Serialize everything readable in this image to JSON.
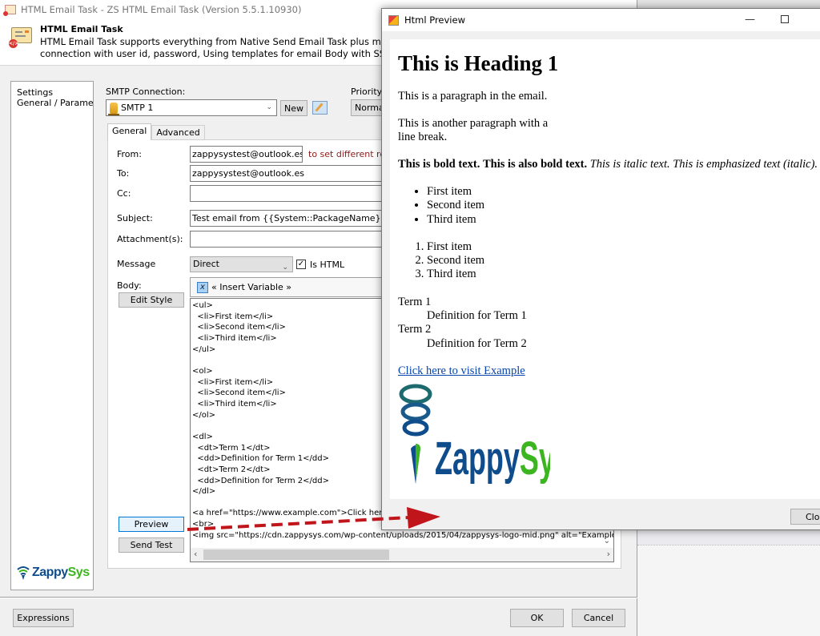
{
  "main_window": {
    "title": "HTML Email Task - ZS HTML Email Task (Version 5.5.1.10930)",
    "header": {
      "title": "HTML Email Task",
      "description_line1": "HTML Email Task supports everything from Native Send Email Task plus much more such",
      "description_line2": "connection with user id, password, Using templates for email Body with SSIS Variable plac"
    },
    "nav": {
      "items": [
        {
          "label": "Settings"
        },
        {
          "label": "General / Parameters"
        }
      ],
      "logo_part1": "Zappy",
      "logo_part2": "Sys"
    },
    "smtp": {
      "label": "SMTP Connection:",
      "selected": "SMTP 1",
      "new_label": "New"
    },
    "priority": {
      "label": "Priority:",
      "selected": "Normal"
    },
    "tabs": [
      {
        "label": "General",
        "active": true
      },
      {
        "label": "Advanced",
        "active": false
      }
    ],
    "form": {
      "from_label": "From:",
      "from_value": "zappysystest@outlook.es",
      "from_note": "to set different reply",
      "to_label": "To:",
      "to_value": "zappysystest@outlook.es",
      "cc_label": "Cc:",
      "cc_value": "",
      "subject_label": "Subject:",
      "subject_value": "Test email from {{System::PackageName}}",
      "attachments_label": "Attachment(s):",
      "attachments_value": "",
      "message_label": "Message",
      "message_selected": "Direct",
      "is_html_label": "Is HTML",
      "is_html_checked": true,
      "body_label": "Body:",
      "insert_variable_label": "« Insert Variable »",
      "edit_style_label": "Edit Style",
      "preview_label": "Preview",
      "send_test_label": "Send Test"
    },
    "body_code": [
      "<ul>",
      "  <li>First item</li>",
      "  <li>Second item</li>",
      "  <li>Third item</li>",
      "</ul>",
      "",
      "<ol>",
      "  <li>First item</li>",
      "  <li>Second item</li>",
      "  <li>Third item</li>",
      "</ol>",
      "",
      "<dl>",
      "  <dt>Term 1</dt>",
      "  <dd>Definition for Term 1</dd>",
      "  <dt>Term 2</dt>",
      "  <dd>Definition for Term 2</dd>",
      "</dl>",
      "",
      "<a href=\"https://www.example.com\">Click here to visit Example</a>",
      "<br>",
      "<img src=\"https://cdn.zappysys.com/wp-content/uploads/2015/04/zappysys-logo-mid.png\" alt=\"Example Image\">"
    ],
    "footer": {
      "expressions_label": "Expressions",
      "ok_label": "OK",
      "cancel_label": "Cancel"
    }
  },
  "preview_window": {
    "title": "Html Preview",
    "heading": "This is Heading 1",
    "paragraph1": "This is a paragraph in the email.",
    "paragraph2_line1": "This is another paragraph with a",
    "paragraph2_line2": "line break.",
    "bold1": "This is bold text.",
    "bold2": "This is also bold text.",
    "italic1": "This is italic text.",
    "italic2": "This is emphasized text (italic).",
    "ul_items": [
      "First item",
      "Second item",
      "Third item"
    ],
    "ol_items": [
      "First item",
      "Second item",
      "Third item"
    ],
    "definitions": [
      {
        "term": "Term 1",
        "definition": "Definition for Term 1"
      },
      {
        "term": "Term 2",
        "definition": "Definition for Term 2"
      }
    ],
    "link_text": "Click here to visit Example",
    "logo_part1": "Zappy",
    "logo_part2": "Sys",
    "close_label": "Close"
  },
  "colors": {
    "accent_blue": "#0078d7",
    "zappysys_blue": "#0f4c8c",
    "zappysys_green": "#3cb521",
    "note_red": "#8b1a1a",
    "arrow_red": "#c0161b",
    "link_blue": "#0645ad"
  }
}
